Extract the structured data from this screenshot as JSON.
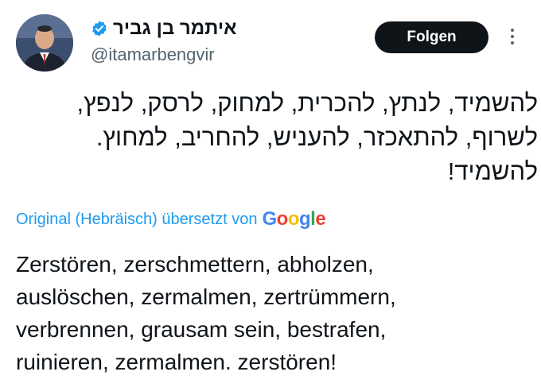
{
  "author": {
    "name": "איתמר בן גביר",
    "handle": "@itamarbengvir",
    "verified": true
  },
  "follow_label": "Folgen",
  "tweet_lines": [
    "להשמיד, לנתץ, להכרית, למחוק, לרסק, לנפץ,",
    "לשרוף, להתאכזר, להעניש, להחריב, למחוץ.",
    "להשמיד!"
  ],
  "translation": {
    "note": "Original (Hebräisch) übersetzt von",
    "provider_letters": [
      "G",
      "o",
      "o",
      "g",
      "l",
      "e"
    ],
    "lines": [
      "Zerstören, zerschmettern, abholzen,",
      "auslöschen, zermalmen, zertrümmern,",
      "verbrennen, grausam sein, bestrafen,",
      "ruinieren, zermalmen. zerstören!"
    ]
  },
  "colors": {
    "text": "#0f1419",
    "secondary": "#536471",
    "link_blue": "#1d9bf0",
    "verified_badge": "#1d9bf0",
    "follow_button_bg": "#0f1419",
    "google": [
      "#4285F4",
      "#EA4335",
      "#FBBC05",
      "#4285F4",
      "#34A853",
      "#EA4335"
    ]
  }
}
